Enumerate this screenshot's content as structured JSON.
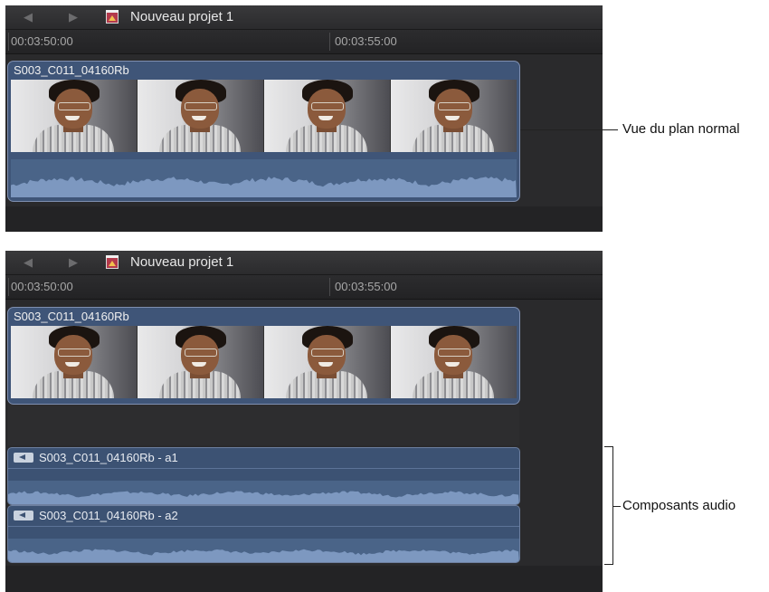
{
  "panel_top": {
    "project_title": "Nouveau projet 1",
    "timecodes": [
      "00:03:50:00",
      "00:03:55:00"
    ],
    "clip_name": "S003_C011_04160Rb"
  },
  "panel_bottom": {
    "project_title": "Nouveau projet 1",
    "timecodes": [
      "00:03:50:00",
      "00:03:55:00"
    ],
    "clip_name": "S003_C011_04160Rb",
    "audio_components": [
      {
        "label": "S003_C011_04160Rb - a1"
      },
      {
        "label": "S003_C011_04160Rb - a2"
      }
    ]
  },
  "annotations": {
    "normal_view": "Vue du plan normal",
    "audio_components": "Composants audio"
  },
  "icons": {
    "nav_back": "back-arrow-icon",
    "nav_forward": "forward-arrow-icon",
    "project": "project-icon",
    "audio_component": "speaker-icon"
  },
  "colors": {
    "clip_blue": "#3f5578",
    "waveform": "#7d98c0",
    "panel_bg": "#2a2a2c"
  }
}
